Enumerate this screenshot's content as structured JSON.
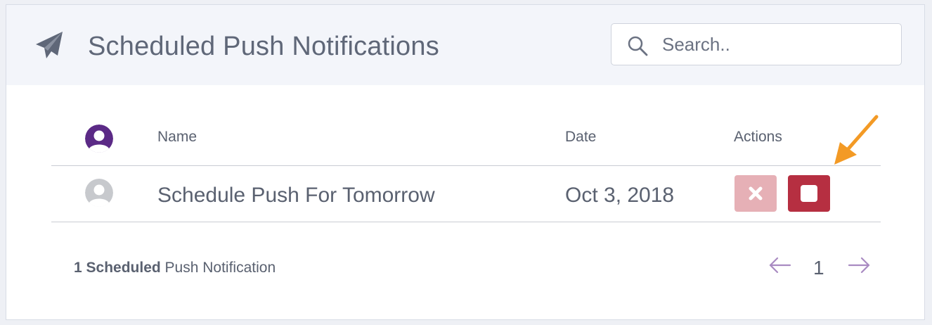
{
  "header": {
    "title": "Scheduled Push Notifications",
    "icon": "paper-plane-icon"
  },
  "search": {
    "placeholder": "Search..",
    "value": "",
    "icon": "search-icon"
  },
  "table": {
    "columns": {
      "avatar_icon": "user-avatar-icon",
      "name": "Name",
      "date": "Date",
      "actions": "Actions"
    },
    "rows": [
      {
        "avatar_icon": "user-avatar-icon",
        "name": "Schedule Push For Tomorrow",
        "date": "Oct 3, 2018",
        "actions": [
          "delete-icon",
          "stop-icon"
        ]
      }
    ]
  },
  "footer": {
    "count_bold": "1 Scheduled",
    "count_rest": " Push Notification"
  },
  "pagination": {
    "prev_icon": "arrow-left-icon",
    "current_page": "1",
    "next_icon": "arrow-right-icon"
  },
  "colors": {
    "header_bg": "#f3f5fa",
    "avatar_header": "#5b2a86",
    "avatar_row": "#c7c9cd",
    "delete_button": "#e6b0b6",
    "stop_button": "#b62f41",
    "pager_arrows": "#a98bc2",
    "annotation_arrow": "#f39a25"
  }
}
